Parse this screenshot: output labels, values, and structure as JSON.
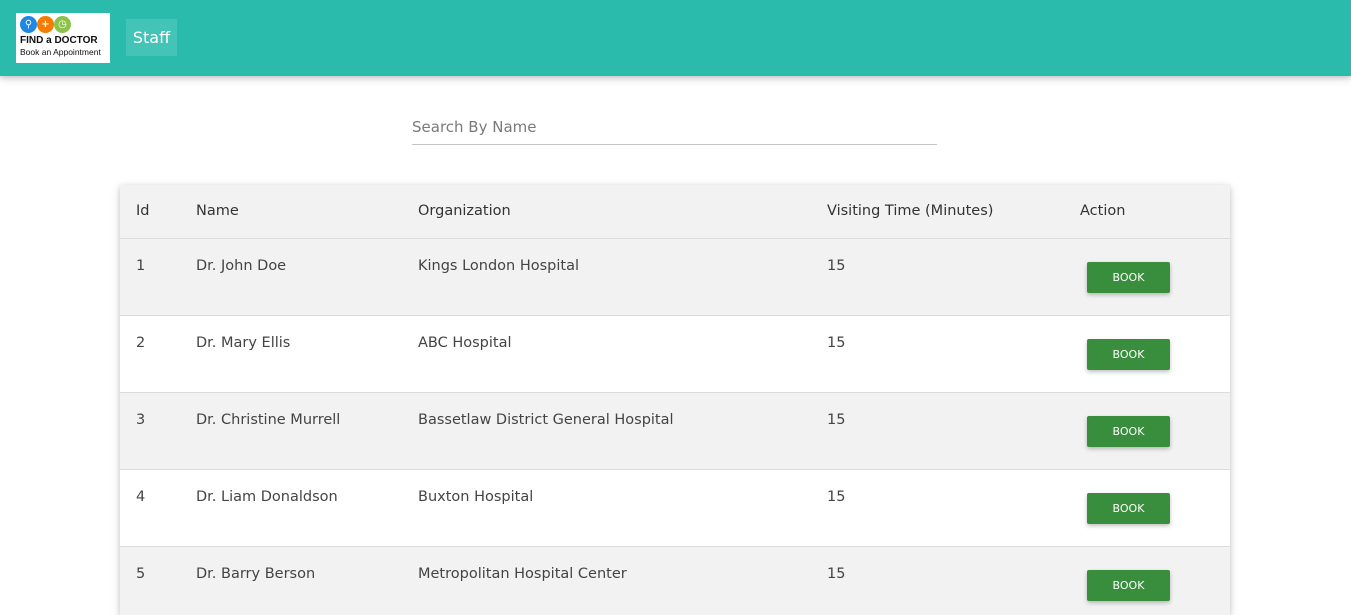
{
  "brand": {
    "title": "FIND a DOCTOR",
    "subtitle": "Book an Appointment",
    "circle_colors": [
      "#1e88e5",
      "#f57c00",
      "#8bc34a"
    ],
    "circle_icons": [
      "search-icon",
      "plus-icon",
      "clock-icon"
    ]
  },
  "nav": {
    "staff_label": "Staff"
  },
  "search": {
    "placeholder": "Search By Name",
    "value": ""
  },
  "table": {
    "columns": [
      "Id",
      "Name",
      "Organization",
      "Visiting Time (Minutes)",
      "Action"
    ],
    "rows": [
      {
        "id": "1",
        "name": "Dr. John Doe",
        "organization": "Kings London Hospital",
        "visiting_time": "15",
        "action": "BOOK"
      },
      {
        "id": "2",
        "name": "Dr. Mary Ellis",
        "organization": "ABC Hospital",
        "visiting_time": "15",
        "action": "BOOK"
      },
      {
        "id": "3",
        "name": "Dr. Christine Murrell",
        "organization": "Bassetlaw District General Hospital",
        "visiting_time": "15",
        "action": "BOOK"
      },
      {
        "id": "4",
        "name": "Dr. Liam Donaldson",
        "organization": "Buxton Hospital",
        "visiting_time": "15",
        "action": "BOOK"
      },
      {
        "id": "5",
        "name": "Dr. Barry Berson",
        "organization": "Metropolitan Hospital Center",
        "visiting_time": "15",
        "action": "BOOK"
      }
    ]
  },
  "colors": {
    "navbar": "#2bbbad",
    "book_button": "#388e3c",
    "row_alt": "#f2f2f2"
  }
}
